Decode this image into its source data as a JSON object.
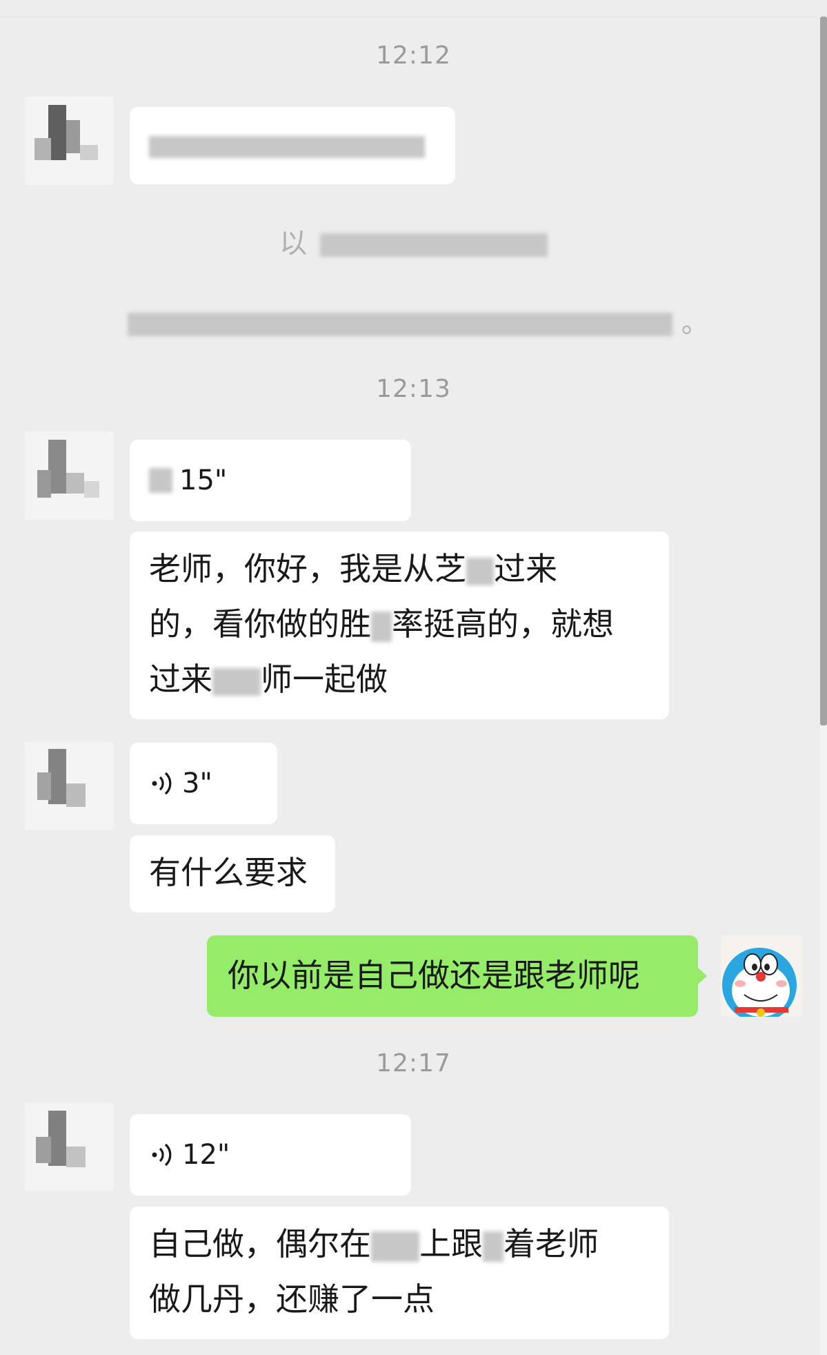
{
  "chat": {
    "times": [
      "12:12",
      "12:13",
      "12:17"
    ],
    "system_first_char": "以",
    "system_end_char": "。",
    "messages": {
      "voice_1_duration": "15\"",
      "text_1_line1": "老师，你好，我是从芝",
      "text_1_line1_end": "过来",
      "text_1_line2_a": "的，看你做的胜",
      "text_1_line2_b": "率挺高的，就想",
      "text_1_line3_a": "过来",
      "text_1_line3_b": "师一起做",
      "voice_2_duration": "3\"",
      "text_2": "有什么要求",
      "self_text": "你以前是自己做还是跟老师呢",
      "voice_3_duration": "12\"",
      "text_3_line1_a": "自己做，偶尔在",
      "text_3_line1_b": "上跟",
      "text_3_line1_c": "着老师",
      "text_3_line2": "做几丹，还赚了一点"
    }
  },
  "colors": {
    "background": "#ededed",
    "bubble_other": "#ffffff",
    "bubble_self": "#95ec69",
    "timestamp": "#9a9a9a"
  },
  "icons": {
    "voice": "voice-wave-icon",
    "self_avatar": "doraemon-avatar"
  }
}
